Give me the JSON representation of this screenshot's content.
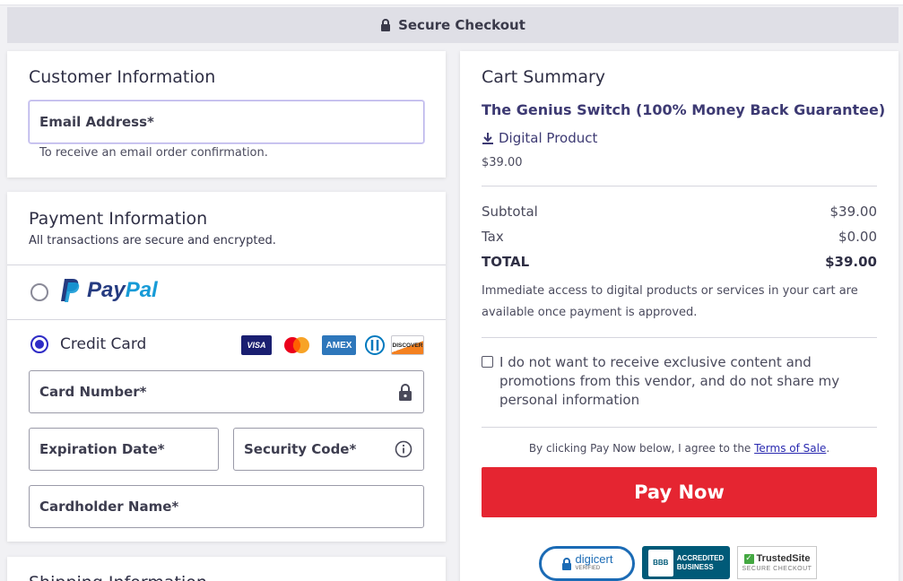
{
  "header": {
    "title": "Secure Checkout"
  },
  "customer": {
    "title": "Customer Information",
    "email_label": "Email Address*",
    "email_hint": "To receive an email order confirmation."
  },
  "payment": {
    "title": "Payment Information",
    "subtitle": "All transactions are secure and encrypted.",
    "paypal_label_pay": "Pay",
    "paypal_label_pal": "Pal",
    "credit_card_label": "Credit Card",
    "selected_method": "Credit Card",
    "card_brands": [
      "VISA",
      "mastercard",
      "AMEX",
      "Diners",
      "DISCOVER"
    ],
    "card_number_label": "Card Number*",
    "expiration_label": "Expiration Date*",
    "security_code_label": "Security Code*",
    "cardholder_label": "Cardholder Name*"
  },
  "shipping": {
    "title": "Shipping Information"
  },
  "cart": {
    "title": "Cart Summary",
    "product_name": "The Genius Switch (100% Money Back Guarantee)",
    "product_type": "Digital Product",
    "product_price": "$39.00",
    "subtotal_label": "Subtotal",
    "subtotal_value": "$39.00",
    "tax_label": "Tax",
    "tax_value": "$0.00",
    "total_label": "TOTAL",
    "total_value": "$39.00",
    "access_note": "Immediate access to digital products or services in your cart are available once payment is approved.",
    "optout_label": "I do not want to receive exclusive content and promotions from this vendor, and do not share my personal information",
    "terms_prefix": "By clicking Pay Now below, I agree to the ",
    "terms_link": "Terms of Sale",
    "terms_suffix": ".",
    "pay_button": "Pay Now"
  },
  "badges": {
    "digicert": "digicert",
    "digicert_sub": "VERIFIED",
    "bbb_line1": "ACCREDITED",
    "bbb_line2": "BUSINESS",
    "bbb_logo": "BBB",
    "trustedsite": "TrustedSite",
    "trustedsite_sub": "SECURE CHECKOUT"
  },
  "colors": {
    "accent": "#2f2cc6",
    "pay_button": "#e52531",
    "paypal_dark": "#253b80",
    "paypal_light": "#179bd7"
  }
}
